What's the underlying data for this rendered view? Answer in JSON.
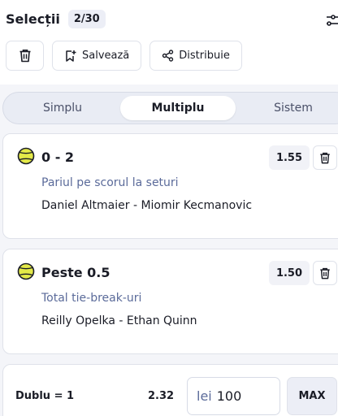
{
  "header": {
    "title": "Selecții",
    "count": "2/30",
    "save_label": "Salvează",
    "share_label": "Distribuie"
  },
  "tabs": [
    {
      "label": "Simplu",
      "active": false
    },
    {
      "label": "Multiplu",
      "active": true
    },
    {
      "label": "Sistem",
      "active": false
    }
  ],
  "selections": [
    {
      "selection": "0 - 2",
      "odds": "1.55",
      "market": "Pariul pe scorul la seturi",
      "match": "Daniel Altmaier - Miomir Kecmanovic"
    },
    {
      "selection": "Peste 0.5",
      "odds": "1.50",
      "market": "Total tie-break-uri",
      "match": "Reilly Opelka - Ethan Quinn"
    }
  ],
  "bet": {
    "type_label": "Dublu = 1",
    "total_odds": "2.32",
    "currency": "lei",
    "stake": "100",
    "max_label": "MAX"
  },
  "colors": {
    "ball_yellow": "#e3e948",
    "ball_outline": "#1a1c26",
    "muted_blue": "#5b6b9a"
  },
  "icons": [
    "trash-icon",
    "bookmark-add-icon",
    "share-icon",
    "settings-sliders-icon",
    "tennis-ball-icon"
  ]
}
